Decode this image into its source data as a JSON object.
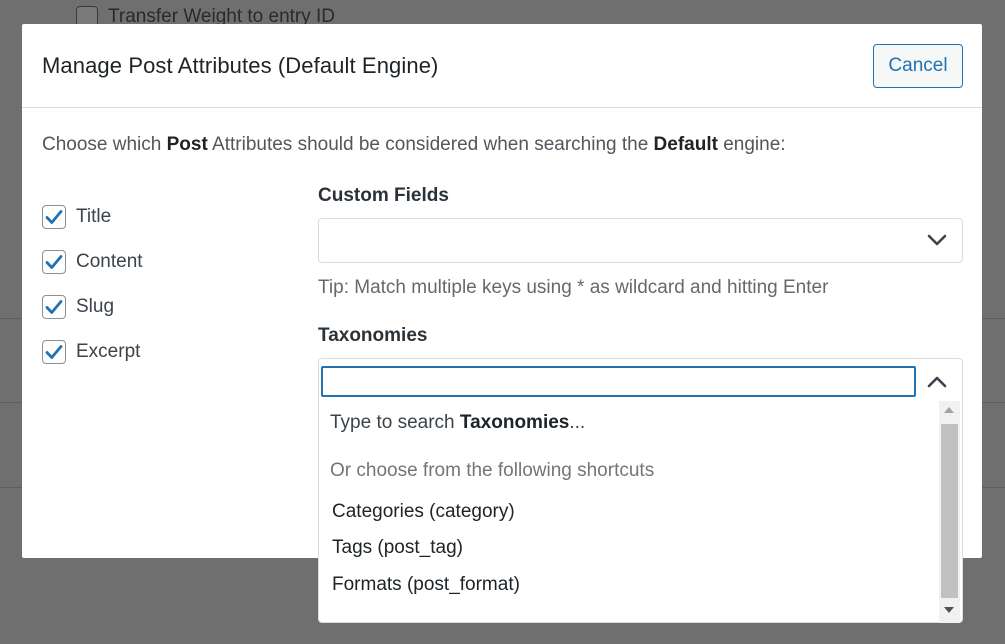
{
  "background": {
    "row_label": "Transfer Weight to entry ID"
  },
  "modal": {
    "title": "Manage Post Attributes (Default Engine)",
    "cancel_label": "Cancel",
    "intro": {
      "part1": "Choose which ",
      "bold1": "Post",
      "part2": " Attributes should be considered when searching the ",
      "bold2": "Default",
      "part3": " engine:"
    },
    "attributes": [
      {
        "label": "Title",
        "checked": true
      },
      {
        "label": "Content",
        "checked": true
      },
      {
        "label": "Slug",
        "checked": true
      },
      {
        "label": "Excerpt",
        "checked": true
      }
    ],
    "custom_fields": {
      "label": "Custom Fields",
      "tip": "Tip: Match multiple keys using * as wildcard and hitting Enter"
    },
    "taxonomies": {
      "label": "Taxonomies",
      "search_prefix": "Type to search ",
      "search_bold": "Taxonomies",
      "search_suffix": "...",
      "shortcuts_heading": "Or choose from the following shortcuts",
      "options": [
        "Categories (category)",
        "Tags (post_tag)",
        "Formats (post_format)"
      ]
    }
  },
  "colors": {
    "accent": "#2271b1",
    "checkmark": "#2271b1",
    "overlay": "#6f6f6f"
  },
  "icons": {
    "checkbox": "checkmark-icon",
    "dropdown_closed": "chevron-down-icon",
    "dropdown_open": "chevron-up-icon"
  }
}
